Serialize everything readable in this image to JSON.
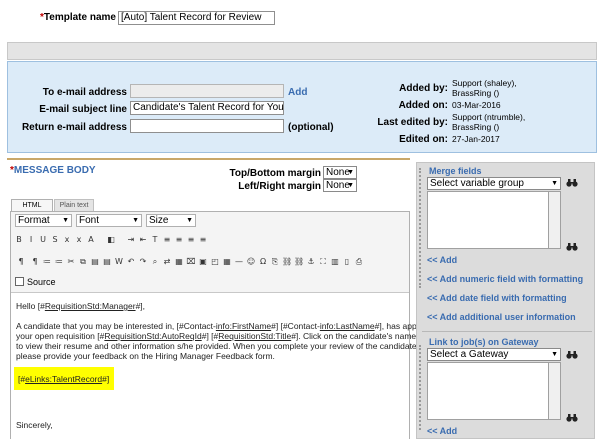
{
  "template": {
    "label": "Template name",
    "value": "[Auto] Talent Record for Review"
  },
  "email": {
    "to_label": "To e-mail address",
    "to_value": "",
    "add_link": "Add",
    "subject_label": "E-mail subject line",
    "subject_value": "Candidate's Talent Record for Your Revie",
    "return_label": "Return e-mail address",
    "return_value": "",
    "optional": "(optional)"
  },
  "meta": {
    "added_by_label": "Added by:",
    "added_by_value": "Support (shaley), BrassRing ()",
    "added_on_label": "Added on:",
    "added_on_value": "03-Mar-2016",
    "last_edited_by_label": "Last edited by:",
    "last_edited_by_value": "Support (ntrumble), BrassRing ()",
    "edited_on_label": "Edited on:",
    "edited_on_value": "27-Jan-2017"
  },
  "message": {
    "title": "MESSAGE BODY",
    "top_bottom_label": "Top/Bottom margin",
    "top_bottom_value": "None",
    "left_right_label": "Left/Right margin",
    "left_right_value": "None"
  },
  "editor": {
    "tabs": [
      "HTML",
      "Plain text"
    ],
    "format": "Format",
    "font": "Font",
    "size": "Size",
    "source": "Source"
  },
  "body": {
    "greeting_pre": "Hello [#",
    "greeting_token": "RequisitionStd:Manager",
    "greeting_post": "#],",
    "p1_a": "A candidate that you may be interested in, [#Contact-",
    "p1_b": "info:FirstName",
    "p1_c": "#] [#Contact-",
    "p1_d": "info:LastName",
    "p1_e": "#], has applied to",
    "p2_a": "your open requisition [#",
    "p2_b": "RequisitionStd:AutoReqId",
    "p2_c": "#] [#",
    "p2_d": "RequisitionStd:Title",
    "p2_e": "#]. Click on the candidate's name below",
    "p3": "to view their resume and other information s/he provided. When you complete your review of the candidate,",
    "p4": "please provide your feedback on the Hiring Manager Feedback form.",
    "link_pre": "[#",
    "link_token": "eLinks:TalentRecord",
    "link_post": "#]",
    "closing": "Sincerely,"
  },
  "merge": {
    "title": "Merge fields",
    "select": "Select variable group",
    "add": "<< Add",
    "add_numeric": "<< Add numeric field with formatting",
    "add_date": "<< Add date field with formatting",
    "add_user": "<< Add additional user information",
    "gateway_title": "Link to job(s) on Gateway",
    "gateway_select": "Select a Gateway",
    "gateway_add": "<< Add"
  },
  "colors": {
    "top_panel": "#dcebf8",
    "top_panel_border": "#9ec0e0",
    "gray_bar": "#e4e4e4",
    "side_panel": "#dcdcdc",
    "link": "#3a6cb0",
    "highlight": "#ffff00",
    "required": "#c00000"
  }
}
